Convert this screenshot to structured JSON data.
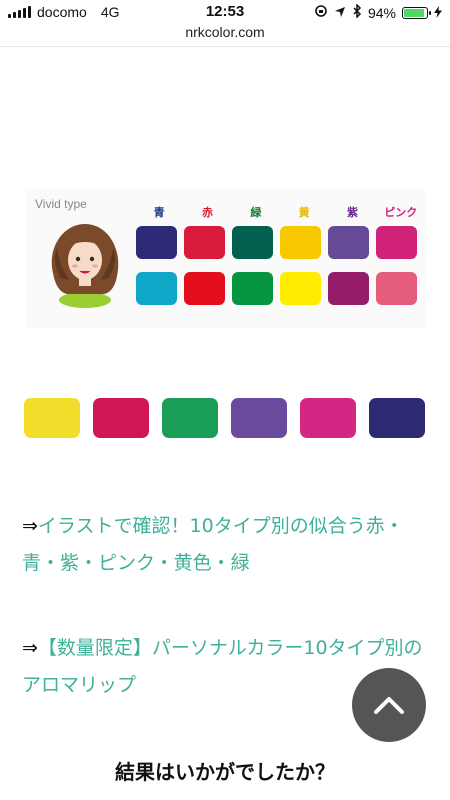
{
  "status_bar": {
    "carrier": "docomo",
    "network": "4G",
    "time": "12:53",
    "battery": "94%",
    "battery_level": 0.94
  },
  "browser": {
    "url": "nrkcolor.com"
  },
  "palette_card": {
    "label": "Vivid type",
    "columns": [
      {
        "label": "青",
        "color": "#1e3a8a"
      },
      {
        "label": "赤",
        "color": "#d0202f"
      },
      {
        "label": "緑",
        "color": "#1b7a3a"
      },
      {
        "label": "黄",
        "color": "#e6b800"
      },
      {
        "label": "紫",
        "color": "#6a2c91"
      },
      {
        "label": "ピンク",
        "color": "#d0227a"
      }
    ],
    "row1": [
      "#2e2a78",
      "#d81a3b",
      "#04604f",
      "#f7c800",
      "#654a96",
      "#cf2278"
    ],
    "row2": [
      "#0fa6c8",
      "#e3101c",
      "#07963f",
      "#ffec00",
      "#941c6b",
      "#e65c7c"
    ]
  },
  "color_row": [
    "#f2dd2b",
    "#cf1757",
    "#1a9d56",
    "#6a4a9c",
    "#d42785",
    "#2c2a73"
  ],
  "links": [
    {
      "arrow": "⇒",
      "text": "イラストで確認！10タイプ別の似合う赤・青・紫・ピンク・黄色・緑"
    },
    {
      "arrow": "⇒",
      "text": "【数量限定】パーソナルカラー10タイプ別のアロマリップ"
    }
  ],
  "heading": "結果はいかがでしたか？",
  "icons": {
    "signal": "signal-icon",
    "battery": "battery-icon",
    "scroll_top": "chevron-up-icon"
  }
}
